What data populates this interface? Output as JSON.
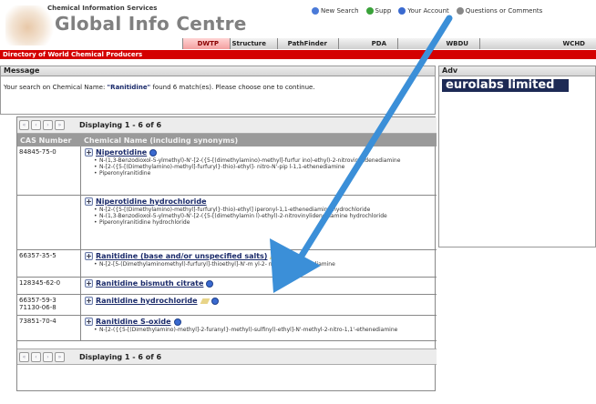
{
  "header": {
    "subtitle": "Chemical Information Services",
    "title": "Global Info Centre",
    "links": [
      {
        "label": "New Search",
        "icon": "magnifier-icon",
        "color": "#4a7ad8"
      },
      {
        "label": "Supp",
        "icon": "globe-icon",
        "color": "#3aa23a"
      },
      {
        "label": "Your Account",
        "icon": "account-icon",
        "color": "#3a6ad0"
      },
      {
        "label": "Questions or Comments",
        "icon": "question-icon",
        "color": "#888888"
      }
    ],
    "tabs": [
      "DWTP",
      "Structure",
      "PathFinder",
      "PDA",
      "WBDU",
      "WCHD"
    ]
  },
  "section_title": "Directory of World Chemical Producers",
  "message_panel": {
    "title": "Message",
    "text_prefix": "Your search on Chemical Name: ",
    "query": "\"Ranitidine\"",
    "text_suffix": " found 6 match(es). Please choose one to continue."
  },
  "adv_panel": {
    "title": "Adv",
    "banner": "eurolabs limited"
  },
  "results": {
    "display_top": "Displaying 1 - 6 of 6",
    "display_bottom": "Displaying 1 - 6 of 6",
    "col_cas": "CAS Number",
    "col_name": "Chemical Name (including synonyms)",
    "rows": [
      {
        "cas": "84845-75-0",
        "name": "Niperotidine",
        "synonyms": [
          "N-(1,3-Benzodioxol-5-ylmethyl)-N'-[2-({5-[(dimethylamino)-methyl]-furfur ino)-ethyl)-2-nitrovinylidenediamine",
          "N-[2-({5-[(Dimethylamino)-methyl]-furfuryl}-thio)-ethyl]- nitro-N'-pip l-1,1-ethenediamine",
          "Piperonylranitidine"
        ]
      },
      {
        "cas": "",
        "name": "Niperotidine hydrochloride",
        "synonyms": [
          "N-[2-({5-[(Dimethylamino)-methyl]-furfuryl}-thio)-ethyl] iperonyl-1,1-ethenediamine hydrochloride",
          "N-(1,3-Benzodioxol-5-ylmethyl)-N'-[2-({5-[(dimethylamin l)-ethyl)-2-nitrovinylidenediamine hydrochloride",
          "Piperonylranitidine hydrochloride"
        ]
      },
      {
        "cas": "66357-35-5",
        "name": "Ranitidine (base and/or unspecified salts)",
        "synonyms": [
          "N-[2-[5-(Dimethylaminomethyl)-furfuryl]-thioethyl]-N'-m yl-2- nitro-1,1-ethenediamine"
        ]
      },
      {
        "cas": "128345-62-0",
        "name": "Ranitidine bismuth citrate",
        "synonyms": []
      },
      {
        "cas": "66357-59-3\n71130-06-8",
        "name": "Ranitidine hydrochloride",
        "synonyms": []
      },
      {
        "cas": "73851-70-4",
        "name": "Ranitidine S-oxide",
        "synonyms": [
          "N-[2-({{5-[(Dimethylamino)-methyl]-2-furanyl}-methyl)-sulfinyl)-ethyl]-N'-methyl-2-nitro-1,1'-ethenediamine"
        ]
      }
    ]
  },
  "overlay": {
    "arrow_color": "#3b8fd8"
  }
}
